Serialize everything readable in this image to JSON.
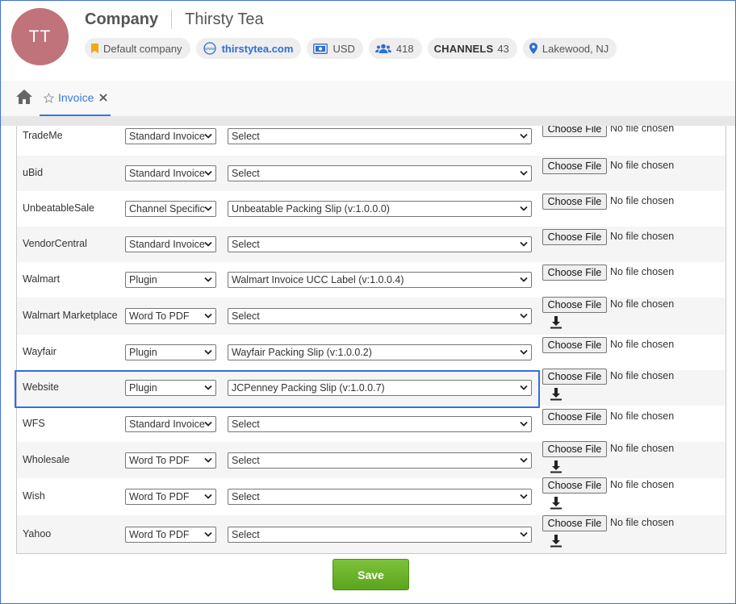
{
  "header": {
    "avatar_initials": "TT",
    "company_label": "Company",
    "company_name": "Thirsty Tea",
    "chips": {
      "default_company": "Default company",
      "website": "thirstytea.com",
      "currency": "USD",
      "users": "418",
      "channels_label": "CHANNELS",
      "channels_count": "43",
      "location": "Lakewood, NJ"
    }
  },
  "tabs": [
    {
      "label": "Invoice"
    }
  ],
  "file_input": {
    "button_label": "Choose File",
    "status": "No file chosen"
  },
  "rows": [
    {
      "channel": "TradeMe",
      "type": "Standard Invoice",
      "template": "Select",
      "download": false
    },
    {
      "channel": "uBid",
      "type": "Standard Invoice",
      "template": "Select",
      "download": false
    },
    {
      "channel": "UnbeatableSale",
      "type": "Channel Specific",
      "template": "Unbeatable Packing Slip (v:1.0.0.0)",
      "download": false
    },
    {
      "channel": "VendorCentral",
      "type": "Standard Invoice",
      "template": "Select",
      "download": false
    },
    {
      "channel": "Walmart",
      "type": "Plugin",
      "template": "Walmart Invoice UCC Label (v:1.0.0.4)",
      "download": false
    },
    {
      "channel": "Walmart Marketplace",
      "type": "Word To PDF",
      "template": "Select",
      "download": true
    },
    {
      "channel": "Wayfair",
      "type": "Plugin",
      "template": "Wayfair Packing Slip (v:1.0.0.2)",
      "download": false
    },
    {
      "channel": "Website",
      "type": "Plugin",
      "template": "JCPenney Packing Slip (v:1.0.0.7)",
      "download": true
    },
    {
      "channel": "WFS",
      "type": "Standard Invoice",
      "template": "Select",
      "download": false
    },
    {
      "channel": "Wholesale",
      "type": "Word To PDF",
      "template": "Select",
      "download": true
    },
    {
      "channel": "Wish",
      "type": "Word To PDF",
      "template": "Select",
      "download": true
    },
    {
      "channel": "Yahoo",
      "type": "Word To PDF",
      "template": "Select",
      "download": true
    }
  ],
  "save_label": "Save",
  "colors": {
    "accent": "#3a78d8",
    "avatar": "#c0737a",
    "save": "#6cb32c",
    "highlight": "#2f6fe0"
  }
}
